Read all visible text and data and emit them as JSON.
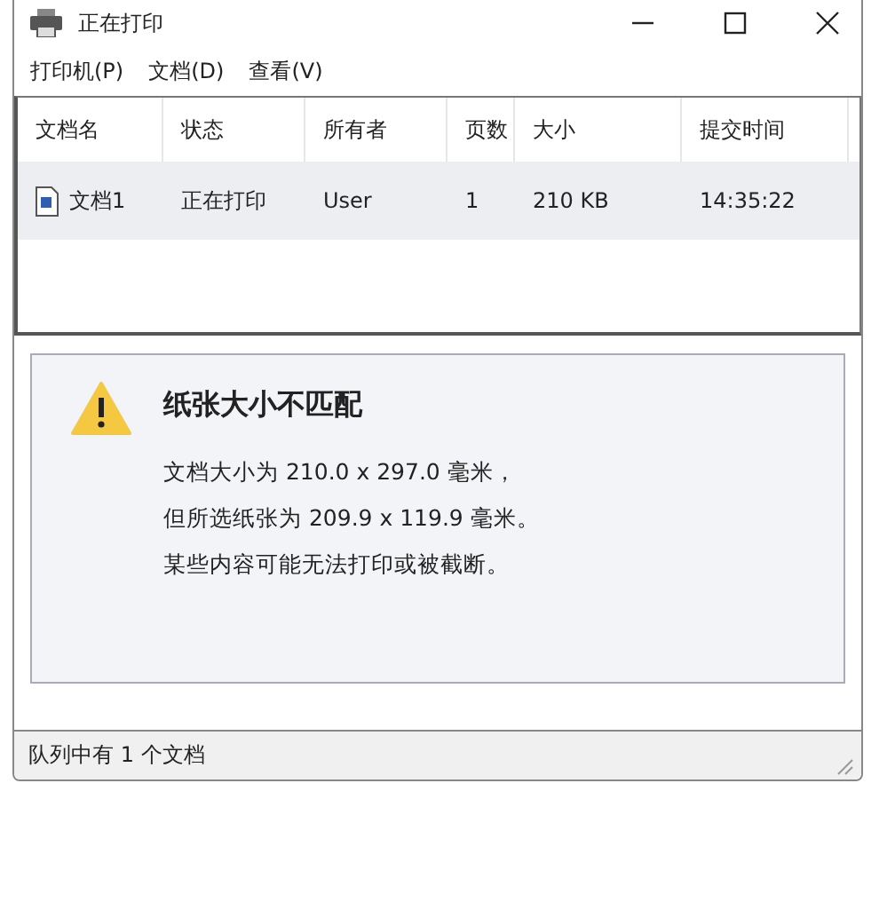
{
  "window": {
    "title": "正在打印"
  },
  "menu": [
    {
      "label": "打印机(P)"
    },
    {
      "label": "文档(D)"
    },
    {
      "label": "查看(V)"
    }
  ],
  "table": {
    "columns": [
      "文档名",
      "状态",
      "所有者",
      "页数",
      "大小",
      "提交时间"
    ],
    "rows": [
      {
        "selected": true,
        "cells": [
          "文档1",
          "正在打印",
          "User",
          "1",
          "210 KB",
          "14:35:22"
        ]
      }
    ]
  },
  "message": {
    "title": "纸张大小不匹配",
    "lines": [
      "文档大小为 210.0 x 297.0 毫米，",
      "但所选纸张为 209.9 x 119.9 毫米。",
      "某些内容可能无法打印或被截断。"
    ]
  },
  "status_bar": "队列中有 1 个文档"
}
